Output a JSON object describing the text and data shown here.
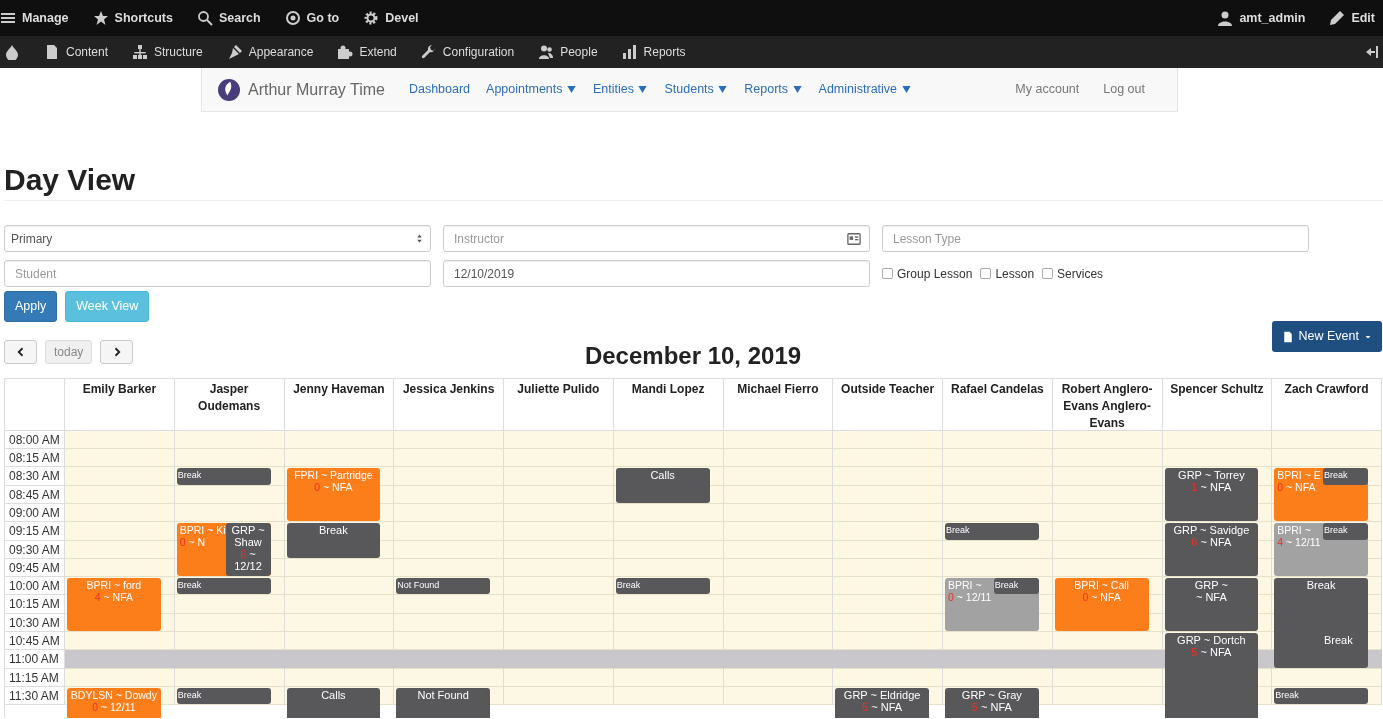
{
  "admin_toolbar": {
    "items": [
      "Manage",
      "Shortcuts",
      "Search",
      "Go to",
      "Devel"
    ],
    "user": "amt_admin",
    "edit": "Edit"
  },
  "admin_tray": {
    "items": [
      "Content",
      "Structure",
      "Appearance",
      "Extend",
      "Configuration",
      "People",
      "Reports"
    ]
  },
  "site_nav": {
    "brand": "Arthur Murray Time",
    "menu": [
      {
        "label": "Dashboard",
        "dropdown": false
      },
      {
        "label": "Appointments",
        "dropdown": true
      },
      {
        "label": "Entities",
        "dropdown": true
      },
      {
        "label": "Students",
        "dropdown": true
      },
      {
        "label": "Reports",
        "dropdown": true
      },
      {
        "label": "Administrative",
        "dropdown": true
      }
    ],
    "right": [
      "My account",
      "Log out"
    ]
  },
  "page_title": "Day View",
  "filters": {
    "type_select": {
      "value": "Primary"
    },
    "instructor": {
      "placeholder": "Instructor"
    },
    "lesson_type": {
      "placeholder": "Lesson Type"
    },
    "student": {
      "placeholder": "Student"
    },
    "date": {
      "value": "12/10/2019"
    },
    "checkboxes": [
      {
        "label": "Group Lesson",
        "checked": false
      },
      {
        "label": "Lesson",
        "checked": false
      },
      {
        "label": "Services",
        "checked": false
      }
    ]
  },
  "buttons": [
    {
      "label": "Apply",
      "kind": "primary"
    },
    {
      "label": "Week View",
      "kind": "info"
    }
  ],
  "calendar": {
    "today": {
      "label": "today",
      "disabled": true
    },
    "title": "December 10, 2019",
    "new_event": "New Event",
    "columns": [
      "Emily Barker",
      "Jasper Oudemans",
      "Jenny Haveman",
      "Jessica Jenkins",
      "Juliette Pulido",
      "Mandi Lopez",
      "Michael Fierro",
      "Outside Teacher",
      "Rafael Candelas",
      "Robert Anglero-Evans Anglero-Evans",
      "Spencer Schultz",
      "Zach Crawford"
    ],
    "times": [
      {
        "label": "08:00 AM",
        "blocked": false,
        "cells": [
          {
            "kind": "free"
          },
          {
            "kind": "free"
          },
          {
            "kind": "free"
          },
          {
            "kind": "free"
          },
          {
            "kind": "free"
          },
          {
            "kind": "free"
          },
          {
            "kind": "free"
          },
          {
            "kind": "free"
          },
          {
            "kind": "free"
          },
          {
            "kind": "free"
          },
          {
            "kind": "free"
          },
          {
            "kind": "free"
          }
        ]
      },
      {
        "label": "08:15 AM",
        "blocked": false,
        "cells": [
          {
            "kind": "free"
          },
          {
            "kind": "free"
          },
          {
            "kind": "free"
          },
          {
            "kind": "free"
          },
          {
            "kind": "free"
          },
          {
            "kind": "free"
          },
          {
            "kind": "free"
          },
          {
            "kind": "free"
          },
          {
            "kind": "free"
          },
          {
            "kind": "free"
          },
          {
            "kind": "free"
          },
          {
            "kind": "free"
          }
        ]
      },
      {
        "label": "08:30 AM",
        "blocked": false,
        "cells": [
          {
            "kind": "free"
          },
          {
            "kind": "start",
            "events": [
              {
                "kind": "mini",
                "half": false,
                "lines": [
                  {
                    "text": "Break"
                  }
                ]
              }
            ]
          },
          {
            "kind": "start",
            "events": [
              {
                "kind": "lesson",
                "half": false,
                "lines": [
                  {
                    "text": "FPRI ~ Partridge"
                  },
                  {
                    "count": "0",
                    "text": " ~ NFA"
                  }
                ]
              }
            ]
          },
          {
            "kind": "free"
          },
          {
            "kind": "free"
          },
          {
            "kind": "start",
            "events": [
              {
                "kind": "group",
                "half": false,
                "lines": [
                  {
                    "text": "Calls"
                  }
                ]
              }
            ]
          },
          {
            "kind": "free"
          },
          {
            "kind": "free"
          },
          {
            "kind": "free"
          },
          {
            "kind": "free"
          },
          {
            "kind": "start",
            "events": [
              {
                "kind": "group",
                "half": false,
                "lines": [
                  {
                    "text": "GRP ~ Torrey"
                  },
                  {
                    "count": "1",
                    "text": " ~ NFA"
                  }
                ]
              }
            ]
          },
          {
            "kind": "start",
            "events": [
              {
                "kind": "lesson",
                "half": false,
                "lines": [
                  {
                    "text": "BPRI ~ E"
                  },
                  {
                    "count": "0",
                    "text": " ~ NFA"
                  }
                ]
              },
              {
                "kind": "mini",
                "half": true,
                "lines": [
                  {
                    "text": "Break"
                  }
                ]
              }
            ]
          }
        ]
      },
      {
        "label": "08:45 AM",
        "blocked": false,
        "cells": [
          {
            "kind": "free"
          },
          {
            "kind": "free"
          },
          {
            "kind": "busy"
          },
          {
            "kind": "free"
          },
          {
            "kind": "free"
          },
          {
            "kind": "busy"
          },
          {
            "kind": "free"
          },
          {
            "kind": "free"
          },
          {
            "kind": "free"
          },
          {
            "kind": "free"
          },
          {
            "kind": "busy"
          },
          {
            "kind": "busy"
          }
        ]
      },
      {
        "label": "09:00 AM",
        "blocked": false,
        "cells": [
          {
            "kind": "free"
          },
          {
            "kind": "free"
          },
          {
            "kind": "busy"
          },
          {
            "kind": "free"
          },
          {
            "kind": "free"
          },
          {
            "kind": "free"
          },
          {
            "kind": "free"
          },
          {
            "kind": "free"
          },
          {
            "kind": "free"
          },
          {
            "kind": "free"
          },
          {
            "kind": "busy"
          },
          {
            "kind": "busy"
          }
        ]
      },
      {
        "label": "09:15 AM",
        "blocked": false,
        "cells": [
          {
            "kind": "free"
          },
          {
            "kind": "start",
            "events": [
              {
                "kind": "lesson",
                "half": false,
                "lines": [
                  {
                    "text": "BPRI ~ Ki"
                  },
                  {
                    "count": "0",
                    "text": " ~ N"
                  }
                ]
              },
              {
                "kind": "group",
                "half": true,
                "lines": [
                  {
                    "text": "GRP ~"
                  },
                  {
                    "text": "Shaw"
                  },
                  {
                    "count": "6",
                    "text": " ~"
                  },
                  {
                    "text": "12/12"
                  }
                ]
              }
            ]
          },
          {
            "kind": "start",
            "events": [
              {
                "kind": "group",
                "half": false,
                "lines": [
                  {
                    "text": "Break"
                  }
                ]
              }
            ]
          },
          {
            "kind": "free"
          },
          {
            "kind": "free"
          },
          {
            "kind": "free"
          },
          {
            "kind": "free"
          },
          {
            "kind": "free"
          },
          {
            "kind": "start",
            "events": [
              {
                "kind": "mini",
                "half": false,
                "lines": [
                  {
                    "text": "Break"
                  }
                ]
              }
            ]
          },
          {
            "kind": "free"
          },
          {
            "kind": "start",
            "events": [
              {
                "kind": "group",
                "half": false,
                "lines": [
                  {
                    "text": "GRP ~ Savidge"
                  },
                  {
                    "count": "6",
                    "text": " ~ NFA"
                  }
                ]
              }
            ]
          },
          {
            "kind": "start",
            "events": [
              {
                "kind": "past",
                "half": false,
                "lines": [
                  {
                    "text": "BPRI ~"
                  },
                  {
                    "count": "4",
                    "text": " ~ 12/11"
                  }
                ]
              },
              {
                "kind": "mini",
                "half": true,
                "lines": [
                  {
                    "text": "Break"
                  }
                ]
              }
            ]
          }
        ]
      },
      {
        "label": "09:30 AM",
        "blocked": false,
        "cells": [
          {
            "kind": "free"
          },
          {
            "kind": "busy"
          },
          {
            "kind": "busy"
          },
          {
            "kind": "free"
          },
          {
            "kind": "free"
          },
          {
            "kind": "free"
          },
          {
            "kind": "free"
          },
          {
            "kind": "free"
          },
          {
            "kind": "free"
          },
          {
            "kind": "free"
          },
          {
            "kind": "busy"
          },
          {
            "kind": "busy"
          }
        ]
      },
      {
        "label": "09:45 AM",
        "blocked": false,
        "cells": [
          {
            "kind": "free"
          },
          {
            "kind": "busy"
          },
          {
            "kind": "free"
          },
          {
            "kind": "free"
          },
          {
            "kind": "free"
          },
          {
            "kind": "free"
          },
          {
            "kind": "free"
          },
          {
            "kind": "free"
          },
          {
            "kind": "free"
          },
          {
            "kind": "free"
          },
          {
            "kind": "busy"
          },
          {
            "kind": "busy"
          }
        ]
      },
      {
        "label": "10:00 AM",
        "blocked": false,
        "cells": [
          {
            "kind": "start",
            "events": [
              {
                "kind": "lesson",
                "half": false,
                "lines": [
                  {
                    "text": "BPRI ~ ford"
                  },
                  {
                    "count": "4",
                    "text": " ~ NFA"
                  }
                ]
              }
            ]
          },
          {
            "kind": "start",
            "events": [
              {
                "kind": "mini",
                "half": false,
                "lines": [
                  {
                    "text": "Break"
                  }
                ]
              }
            ]
          },
          {
            "kind": "free"
          },
          {
            "kind": "start",
            "events": [
              {
                "kind": "mini",
                "half": false,
                "lines": [
                  {
                    "text": "Not Found"
                  }
                ]
              }
            ]
          },
          {
            "kind": "free"
          },
          {
            "kind": "start",
            "events": [
              {
                "kind": "mini",
                "half": false,
                "lines": [
                  {
                    "text": "Break"
                  }
                ]
              }
            ]
          },
          {
            "kind": "free"
          },
          {
            "kind": "free"
          },
          {
            "kind": "start",
            "events": [
              {
                "kind": "past",
                "half": false,
                "lines": [
                  {
                    "text": "BPRI ~"
                  },
                  {
                    "count": "0",
                    "text": " ~ 12/11"
                  }
                ]
              },
              {
                "kind": "mini",
                "half": true,
                "lines": [
                  {
                    "text": "Break"
                  }
                ]
              }
            ]
          },
          {
            "kind": "start",
            "events": [
              {
                "kind": "lesson",
                "half": false,
                "lines": [
                  {
                    "text": "BPRI ~ Call"
                  },
                  {
                    "count": "0",
                    "text": " ~ NFA"
                  }
                ]
              }
            ]
          },
          {
            "kind": "start",
            "events": [
              {
                "kind": "group",
                "half": false,
                "lines": [
                  {
                    "text": "GRP ~"
                  },
                  {
                    "text": "~ NFA"
                  }
                ]
              }
            ]
          },
          {
            "kind": "start",
            "events": [
              {
                "kind": "group",
                "half": false,
                "lines": [
                  {
                    "text": "Break"
                  }
                ]
              }
            ]
          }
        ]
      },
      {
        "label": "10:15 AM",
        "blocked": false,
        "cells": [
          {
            "kind": "busy"
          },
          {
            "kind": "free"
          },
          {
            "kind": "free"
          },
          {
            "kind": "free"
          },
          {
            "kind": "free"
          },
          {
            "kind": "free"
          },
          {
            "kind": "free"
          },
          {
            "kind": "free"
          },
          {
            "kind": "busy"
          },
          {
            "kind": "busy"
          },
          {
            "kind": "busy"
          },
          {
            "kind": "busy"
          }
        ]
      },
      {
        "label": "10:30 AM",
        "blocked": false,
        "cells": [
          {
            "kind": "busy"
          },
          {
            "kind": "free"
          },
          {
            "kind": "free"
          },
          {
            "kind": "free"
          },
          {
            "kind": "free"
          },
          {
            "kind": "free"
          },
          {
            "kind": "free"
          },
          {
            "kind": "free"
          },
          {
            "kind": "busy"
          },
          {
            "kind": "busy"
          },
          {
            "kind": "busy"
          },
          {
            "kind": "busy"
          }
        ]
      },
      {
        "label": "10:45 AM",
        "blocked": false,
        "cells": [
          {
            "kind": "free"
          },
          {
            "kind": "free"
          },
          {
            "kind": "free"
          },
          {
            "kind": "free"
          },
          {
            "kind": "free"
          },
          {
            "kind": "free"
          },
          {
            "kind": "free"
          },
          {
            "kind": "free"
          },
          {
            "kind": "free"
          },
          {
            "kind": "free"
          },
          {
            "kind": "start",
            "events": [
              {
                "kind": "group",
                "half": false,
                "lines": [
                  {
                    "text": "GRP ~ Dortch"
                  },
                  {
                    "count": "5",
                    "text": " ~ NFA"
                  }
                ]
              }
            ]
          },
          {
            "kind": "start",
            "events": [
              {
                "kind": "mini",
                "half": true,
                "lines": [
                  {
                    "text": "Break"
                  }
                ]
              }
            ]
          }
        ]
      },
      {
        "label": "11:00 AM",
        "blocked": true,
        "cells": [
          {
            "kind": "free"
          },
          {
            "kind": "free"
          },
          {
            "kind": "free"
          },
          {
            "kind": "free"
          },
          {
            "kind": "free"
          },
          {
            "kind": "free"
          },
          {
            "kind": "free"
          },
          {
            "kind": "free"
          },
          {
            "kind": "free"
          },
          {
            "kind": "free"
          },
          {
            "kind": "busy"
          },
          {
            "kind": "busy"
          }
        ]
      },
      {
        "label": "11:15 AM",
        "blocked": false,
        "cells": [
          {
            "kind": "free"
          },
          {
            "kind": "free"
          },
          {
            "kind": "free"
          },
          {
            "kind": "free"
          },
          {
            "kind": "free"
          },
          {
            "kind": "free"
          },
          {
            "kind": "free"
          },
          {
            "kind": "free"
          },
          {
            "kind": "free"
          },
          {
            "kind": "free"
          },
          {
            "kind": "busy"
          },
          {
            "kind": "free"
          }
        ]
      },
      {
        "label": "11:30 AM",
        "blocked": false,
        "cells": [
          {
            "kind": "start",
            "events": [
              {
                "kind": "lesson",
                "half": false,
                "lines": [
                  {
                    "text": "BDYLSN ~ Dowdy"
                  },
                  {
                    "count": "0",
                    "text": " ~ 12/11"
                  }
                ]
              }
            ]
          },
          {
            "kind": "start",
            "events": [
              {
                "kind": "mini",
                "half": false,
                "lines": [
                  {
                    "text": "Break"
                  }
                ]
              }
            ]
          },
          {
            "kind": "start",
            "events": [
              {
                "kind": "group",
                "half": false,
                "lines": [
                  {
                    "text": "Calls"
                  }
                ]
              }
            ]
          },
          {
            "kind": "start",
            "events": [
              {
                "kind": "group",
                "half": false,
                "lines": [
                  {
                    "text": "Not Found"
                  }
                ]
              }
            ]
          },
          {
            "kind": "free"
          },
          {
            "kind": "free"
          },
          {
            "kind": "free"
          },
          {
            "kind": "start",
            "events": [
              {
                "kind": "group",
                "half": false,
                "lines": [
                  {
                    "text": "GRP ~ Eldridge"
                  },
                  {
                    "count": "5",
                    "text": " ~ NFA"
                  }
                ]
              }
            ]
          },
          {
            "kind": "start",
            "events": [
              {
                "kind": "group",
                "half": false,
                "lines": [
                  {
                    "text": "GRP ~ Gray"
                  },
                  {
                    "count": "5",
                    "text": " ~ NFA"
                  }
                ]
              }
            ]
          },
          {
            "kind": "free"
          },
          {
            "kind": "busy"
          },
          {
            "kind": "start",
            "events": [
              {
                "kind": "mini",
                "half": false,
                "lines": [
                  {
                    "text": "Break"
                  }
                ]
              }
            ]
          }
        ]
      }
    ]
  }
}
